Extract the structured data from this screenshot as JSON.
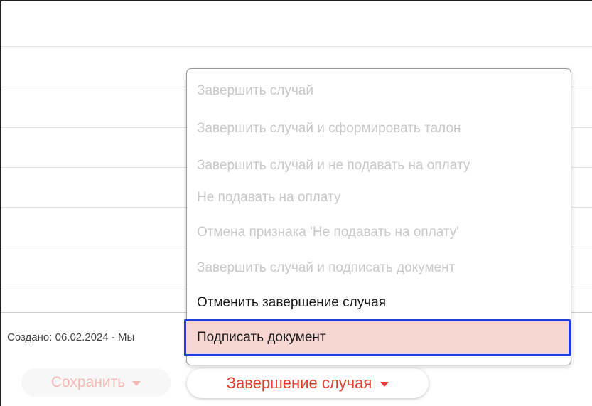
{
  "menu": {
    "items": [
      {
        "label": "Завершить случай",
        "enabled": false
      },
      {
        "label": "Завершить случай и сформировать талон",
        "enabled": false
      },
      {
        "label": "Завершить случай и не подавать на оплату",
        "enabled": false
      },
      {
        "label": "Не подавать на оплату",
        "enabled": false
      },
      {
        "label": "Отмена признака 'Не подавать на оплату'",
        "enabled": false
      },
      {
        "label": "Завершить случай и подписать документ",
        "enabled": false
      },
      {
        "label": "Отменить завершение случая",
        "enabled": true
      },
      {
        "label": "Подписать документ",
        "enabled": true,
        "highlighted": true
      }
    ]
  },
  "footer": {
    "created_text": "Создано: 06.02.2024 - Мы"
  },
  "buttons": {
    "save_label": "Сохранить",
    "finish_label": "Завершение случая"
  },
  "colors": {
    "accent": "#e2402f",
    "disabled_text": "#c9c9c9",
    "highlight_fill": "#f8d6d2",
    "highlight_border": "#1e3fe0"
  }
}
